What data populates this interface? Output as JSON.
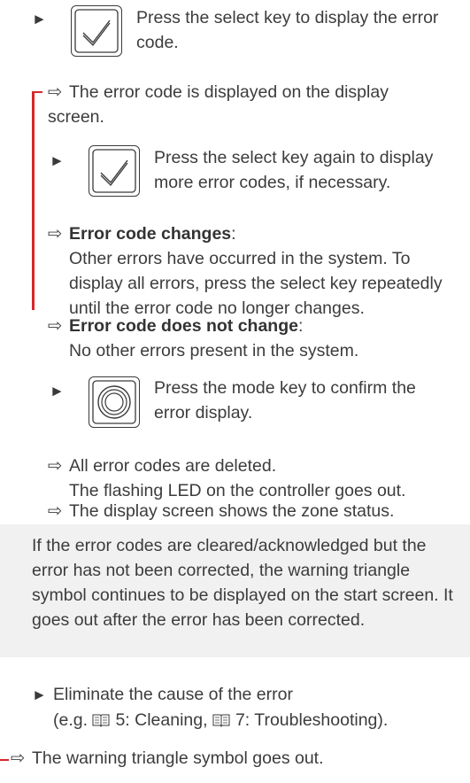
{
  "step1": {
    "arrow": "►",
    "icon": "select-key-icon",
    "text": "Press the select key to display the error code."
  },
  "result1": {
    "arrow": "⇨",
    "text": "The error code is displayed on the display screen."
  },
  "step2": {
    "arrow": "►",
    "icon": "select-key-icon",
    "text": "Press the select key again to display more error codes, if necessary."
  },
  "result_changes": {
    "arrow": "⇨",
    "title": "Error code changes",
    "colon": ":",
    "text": "Other errors have occurred in the system. To display all errors, press the select key repeatedly until the error code no longer changes."
  },
  "result_no_change": {
    "arrow": "⇨",
    "title": "Error code does not change",
    "colon": ":",
    "text": "No other errors present in the system."
  },
  "step3": {
    "arrow": "►",
    "icon": "mode-key-icon",
    "text": "Press the mode key to confirm the error display."
  },
  "result3": {
    "arrow": "⇨",
    "line1": "All error codes are deleted.",
    "line2": "The flashing LED on the controller goes out."
  },
  "result4": {
    "arrow": "⇨",
    "text": "The display screen shows the zone status."
  },
  "note": {
    "text": "If the error codes are cleared/acknowledged but the error has not been corrected, the warning triangle symbol continues to be displayed on the start screen. It goes out after the error has been corrected."
  },
  "step4": {
    "arrow": "►",
    "line1": "Eliminate the cause of the error",
    "ref_open": "(e.g. ",
    "ref1": "5: Cleaning, ",
    "ref2": "7: Troubleshooting).",
    "book_icon": "book-icon"
  },
  "result5": {
    "arrow": "⇨",
    "text": "The warning triangle symbol goes out."
  },
  "colors": {
    "bracket": "#d6262a",
    "note_bg": "#f1f1f1",
    "text": "#3c3c3c"
  }
}
